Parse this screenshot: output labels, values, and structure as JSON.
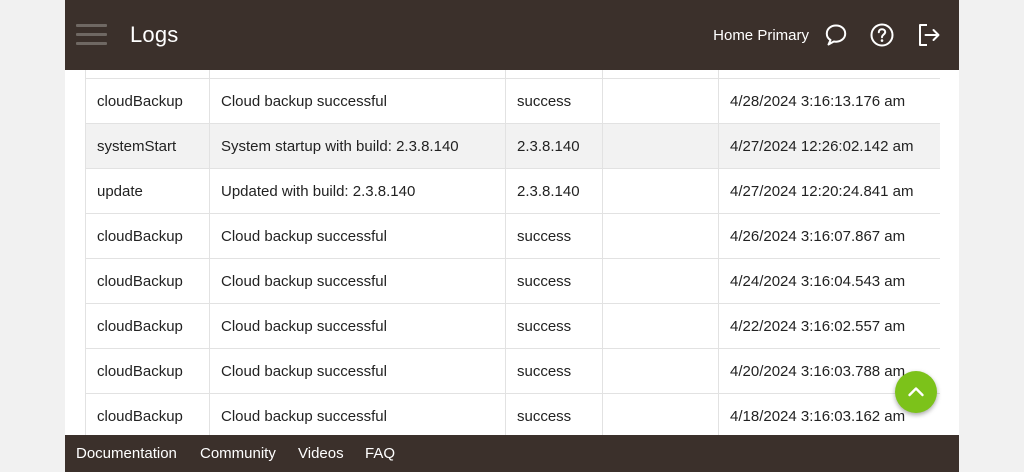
{
  "header": {
    "title": "Logs",
    "hub_name": "Home Primary",
    "menu_icon": "hamburger-menu-icon",
    "icons": [
      "chat-bubble-icon",
      "help-circle-icon",
      "logout-icon"
    ]
  },
  "table": {
    "rows": [
      {
        "name": "",
        "description": "",
        "value": "",
        "extra": "",
        "date": ""
      },
      {
        "name": "cloudBackup",
        "description": "Cloud backup successful",
        "value": "success",
        "extra": "",
        "date": "4/28/2024 3:16:13.176 am"
      },
      {
        "name": "systemStart",
        "description": "System startup with build: 2.3.8.140",
        "value": "2.3.8.140",
        "extra": "",
        "date": "4/27/2024 12:26:02.142 am"
      },
      {
        "name": "update",
        "description": "Updated with build: 2.3.8.140",
        "value": "2.3.8.140",
        "extra": "",
        "date": "4/27/2024 12:20:24.841 am"
      },
      {
        "name": "cloudBackup",
        "description": "Cloud backup successful",
        "value": "success",
        "extra": "",
        "date": "4/26/2024 3:16:07.867 am"
      },
      {
        "name": "cloudBackup",
        "description": "Cloud backup successful",
        "value": "success",
        "extra": "",
        "date": "4/24/2024 3:16:04.543 am"
      },
      {
        "name": "cloudBackup",
        "description": "Cloud backup successful",
        "value": "success",
        "extra": "",
        "date": "4/22/2024 3:16:02.557 am"
      },
      {
        "name": "cloudBackup",
        "description": "Cloud backup successful",
        "value": "success",
        "extra": "",
        "date": "4/20/2024 3:16:03.788 am"
      },
      {
        "name": "cloudBackup",
        "description": "Cloud backup successful",
        "value": "success",
        "extra": "",
        "date": "4/18/2024 3:16:03.162 am"
      }
    ]
  },
  "scroll_top_icon": "chevron-up-icon",
  "footer": {
    "links": [
      "Documentation",
      "Community",
      "Videos",
      "FAQ"
    ]
  },
  "colors": {
    "bar": "#3b302b",
    "accent": "#7cc21a",
    "row_alt": "#f2f2f2",
    "border": "#e2e2e2"
  }
}
